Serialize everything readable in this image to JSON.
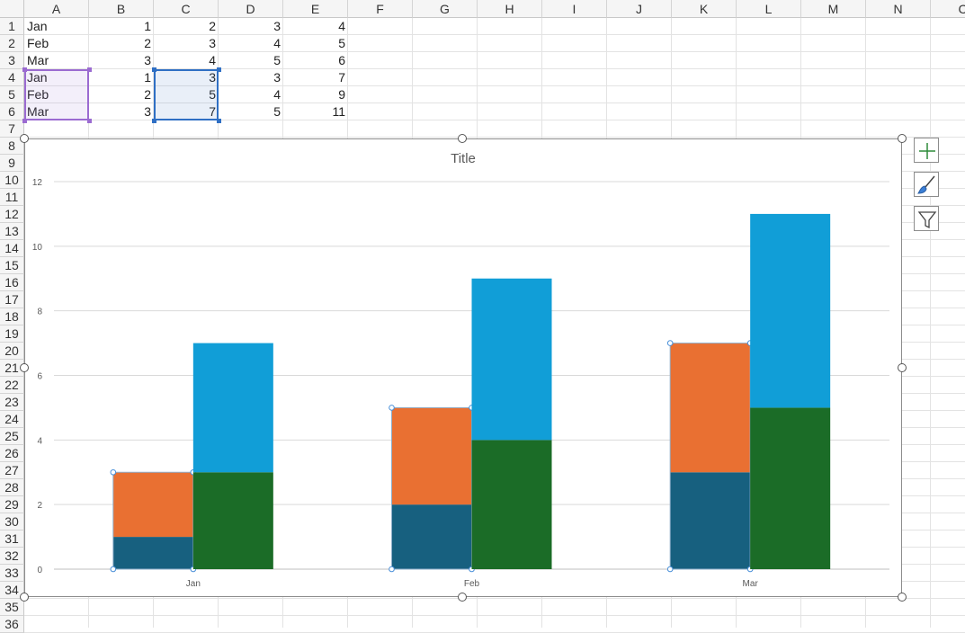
{
  "sheet": {
    "columns": [
      "A",
      "B",
      "C",
      "D",
      "E",
      "F",
      "G",
      "H",
      "I",
      "J",
      "K",
      "L",
      "M",
      "N",
      "C"
    ],
    "rows": [
      "1",
      "2",
      "3",
      "4",
      "5",
      "6",
      "7",
      "8",
      "9",
      "10",
      "11",
      "12",
      "13",
      "14",
      "15",
      "16",
      "17",
      "18",
      "19",
      "20",
      "21",
      "22",
      "23",
      "24",
      "25",
      "26",
      "27",
      "28",
      "29",
      "30",
      "31",
      "32",
      "33",
      "34",
      "35",
      "36"
    ],
    "cells": [
      [
        "Jan",
        "1",
        "2",
        "3",
        "4"
      ],
      [
        "Feb",
        "2",
        "3",
        "4",
        "5"
      ],
      [
        "Mar",
        "3",
        "4",
        "5",
        "6"
      ],
      [
        "Jan",
        "1",
        "3",
        "3",
        "7"
      ],
      [
        "Feb",
        "2",
        "5",
        "4",
        "9"
      ],
      [
        "Mar",
        "3",
        "7",
        "5",
        "11"
      ]
    ]
  },
  "chart_data": {
    "type": "bar",
    "stacked": true,
    "title": "Title",
    "categories": [
      "Jan",
      "Feb",
      "Mar"
    ],
    "stacks": [
      {
        "series": [
          {
            "values": [
              1,
              2,
              3
            ],
            "color": "#17607f"
          },
          {
            "values": [
              2,
              3,
              4
            ],
            "color": "#e97032"
          }
        ]
      },
      {
        "series": [
          {
            "values": [
              3,
              4,
              5
            ],
            "color": "#1b6c27"
          },
          {
            "values": [
              4,
              5,
              6
            ],
            "color": "#119ed7"
          }
        ]
      }
    ],
    "y_ticks": [
      "0",
      "2",
      "4",
      "6",
      "8",
      "10",
      "12"
    ],
    "ylim": [
      0,
      12
    ],
    "grid": true,
    "legend": "none"
  },
  "chart_tools": {
    "add_element": "plus-icon",
    "styles": "paintbrush-icon",
    "filter": "funnel-icon"
  }
}
